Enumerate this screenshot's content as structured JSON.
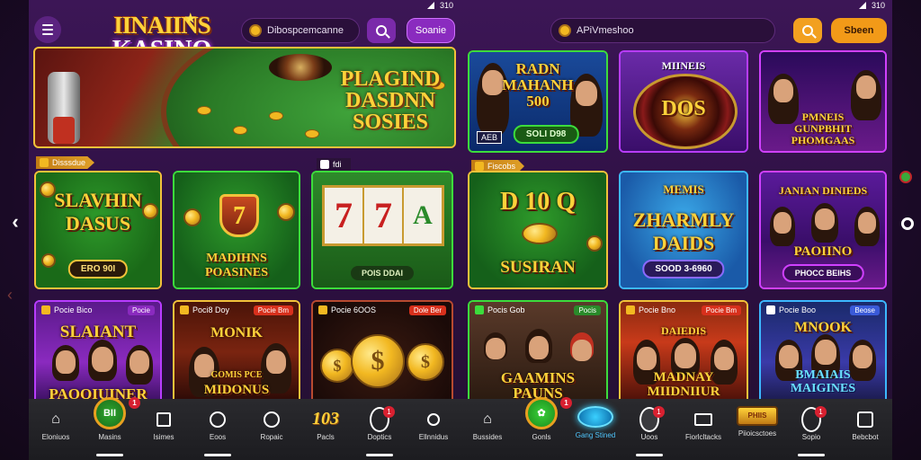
{
  "colors": {
    "accent_purple": "#b83cff",
    "gold": "#f2c23a",
    "green_border": "#3cdc3c",
    "panel_bg": "#3c1656",
    "nav_bg": "#1c1c20"
  },
  "status_bar": {
    "left_time": "310",
    "right_time": "310"
  },
  "left": {
    "logo_line1": "IINAIINS",
    "logo_line2": "KASINO",
    "search_text": "Dibospcemcanne",
    "cta_label": "Soanie",
    "hero": {
      "line1": "PLAGIND",
      "line2": "DASDNN",
      "line3": "SOSIES"
    },
    "section1_label": "Disssdue",
    "section2_label": "fdi",
    "cards_row1": [
      {
        "title_l1": "SLAVHIN",
        "title_l2": "DASUS",
        "pill": "ERO 90I"
      },
      {
        "title_l1": "MADIHNS",
        "title_l2": "POASINES",
        "badge": "7"
      },
      {
        "pill": "POIS DDAI",
        "reels": [
          "7",
          "7",
          "A"
        ]
      }
    ],
    "cards_row2": [
      {
        "corner": "Pocie Bico",
        "corner_r": "Pocie",
        "title_l1": "SLAIANT",
        "title_l2": "PAOQIUINER"
      },
      {
        "corner": "Poci8 Doy",
        "corner_r": "Pocie Bm",
        "title_l1": "MONIK",
        "title_l2": "GOMIS PCE",
        "title_l3": "MIDONUS"
      },
      {
        "corner": "Pocie 6OOS",
        "corner_r": "Dole Ber",
        "coin_symbol": "$"
      }
    ]
  },
  "right": {
    "search_text": "APiVmeshoo",
    "cta_label": "Sbeen",
    "top_cards": [
      {
        "title_l1": "RADN",
        "title_l2": "MAHANH",
        "title_l3": "500",
        "tag": "AEB",
        "pill": "SOLI D98"
      },
      {
        "title": "MIINEIS",
        "wheel_text": "DOS"
      },
      {
        "title_l1": "PMNEIS",
        "title_l2": "GUNPBHIT",
        "title_l3": "PHOMGAAS"
      }
    ],
    "section_label": "Fiscobs",
    "cards_row1": [
      {
        "title_l1": "D 10 Q",
        "title_l2": "SUSIRAN"
      },
      {
        "title_l1": "MEMIS",
        "title_l2": "ZHARMLY",
        "title_l3": "DAIDS",
        "pill": "SOOD 3-6960"
      },
      {
        "title_l1": "JANIAN DINIEDS",
        "title_l2": "PAOIINO",
        "pill": "PHOCC BEIHS"
      }
    ],
    "cards_row2": [
      {
        "corner": "Pocis Gob",
        "corner_r": "Pocis",
        "title_l1": "GAAMINS",
        "title_l2": "PAUNS"
      },
      {
        "corner": "Pocie Bno",
        "corner_r": "Pocie Bm",
        "title_l1": "DAIEDIS",
        "title_l2": "MADNAY",
        "title_l3": "MIIDNIIUR"
      },
      {
        "corner": "Pocie Boo",
        "corner_r": "Beose",
        "title_l1": "MNOOK",
        "title_l2": "BMAIAIS",
        "title_l3": "MAIGINES"
      }
    ]
  },
  "nav_left": [
    {
      "label": "Eloniuos",
      "icon": "home-icon"
    },
    {
      "label": "Masins",
      "icon": "chip-icon",
      "badge": "1",
      "chip_text": "BII"
    },
    {
      "label": "Isimes",
      "icon": "edit-icon"
    },
    {
      "label": "Eoos",
      "icon": "target-icon"
    },
    {
      "label": "Ropaic",
      "icon": "clock-icon"
    },
    {
      "label": "Pacls",
      "icon": "103-icon",
      "number": "103"
    },
    {
      "label": "Doptics",
      "icon": "circle-icon",
      "badge": "1"
    },
    {
      "label": "Ellnnidus",
      "icon": "search-icon"
    }
  ],
  "nav_right": [
    {
      "label": "Bussides",
      "icon": "home-icon"
    },
    {
      "label": "Gonls",
      "icon": "leaf-icon",
      "badge": "1"
    },
    {
      "label": "Gang Stined",
      "icon": "earth-icon"
    },
    {
      "label": "Uoos",
      "icon": "chip-icon",
      "badge": "1"
    },
    {
      "label": "Fiorlcltacks",
      "icon": "wallet-icon"
    },
    {
      "label": "Piioicsctoes",
      "icon": "chest-icon",
      "chest_text": "PHIIS"
    },
    {
      "label": "Sopio",
      "icon": "compass-icon",
      "badge": "1"
    },
    {
      "label": "Bebcbot",
      "icon": "bag-icon"
    }
  ]
}
